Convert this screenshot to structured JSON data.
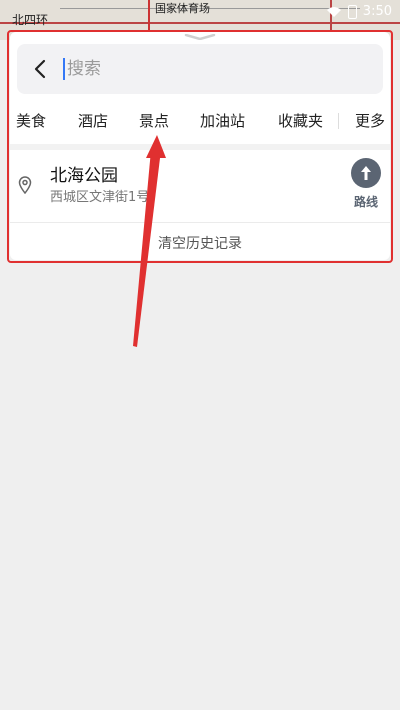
{
  "map": {
    "label_left": "北四环",
    "label_top": "国家体育场",
    "time": "3:50"
  },
  "search": {
    "placeholder": "搜索",
    "back_icon": "chevron-left-icon"
  },
  "categories": [
    "美食",
    "酒店",
    "景点",
    "加油站",
    "收藏夹",
    "更多"
  ],
  "history": {
    "items": [
      {
        "name": "北海公园",
        "address": "西城区文津街1号",
        "route_label": "路线",
        "icon": "location-pin-icon"
      }
    ],
    "clear_label": "清空历史记录"
  },
  "colors": {
    "annotation": "#e03030",
    "accent": "#3478f6",
    "route_button": "#5b6573"
  }
}
